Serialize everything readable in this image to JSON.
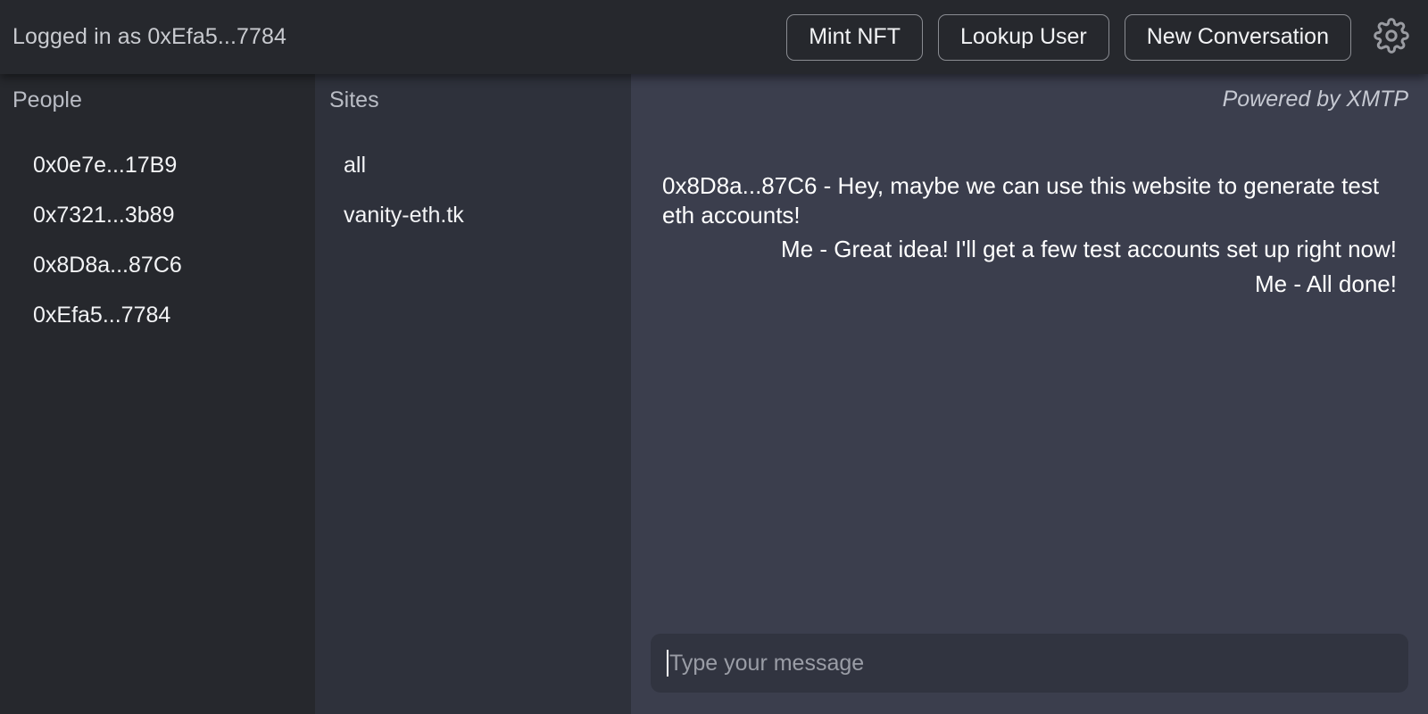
{
  "topbar": {
    "logged_in_text": "Logged in as 0xEfa5...7784",
    "buttons": [
      {
        "label": "Mint NFT",
        "name": "mint-nft-button"
      },
      {
        "label": "Lookup User",
        "name": "lookup-user-button"
      },
      {
        "label": "New Conversation",
        "name": "new-conversation-button"
      }
    ],
    "settings_icon": "gear-icon",
    "background": "#26282d"
  },
  "people_panel": {
    "title": "People",
    "background": "#26282d",
    "items": [
      {
        "label": "0x0e7e...17B9"
      },
      {
        "label": "0x7321...3b89"
      },
      {
        "label": "0x8D8a...87C6"
      },
      {
        "label": "0xEfa5...7784"
      }
    ]
  },
  "sites_panel": {
    "title": "Sites",
    "background": "#2e313b",
    "items": [
      {
        "label": "all"
      },
      {
        "label": "vanity-eth.tk"
      }
    ]
  },
  "chat_panel": {
    "background": "#3b3e4d",
    "brand": "Powered by XMTP",
    "messages": [
      {
        "align": "incoming",
        "text": "0x8D8a...87C6 - Hey, maybe we can use this website to generate test eth accounts!"
      },
      {
        "align": "outgoing",
        "text": "Me - Great idea! I'll get a few test accounts set up right now!"
      },
      {
        "align": "outgoing",
        "text": "Me - All done!"
      }
    ],
    "composer": {
      "value": "",
      "placeholder": "Type your message",
      "background": "#313440"
    }
  }
}
